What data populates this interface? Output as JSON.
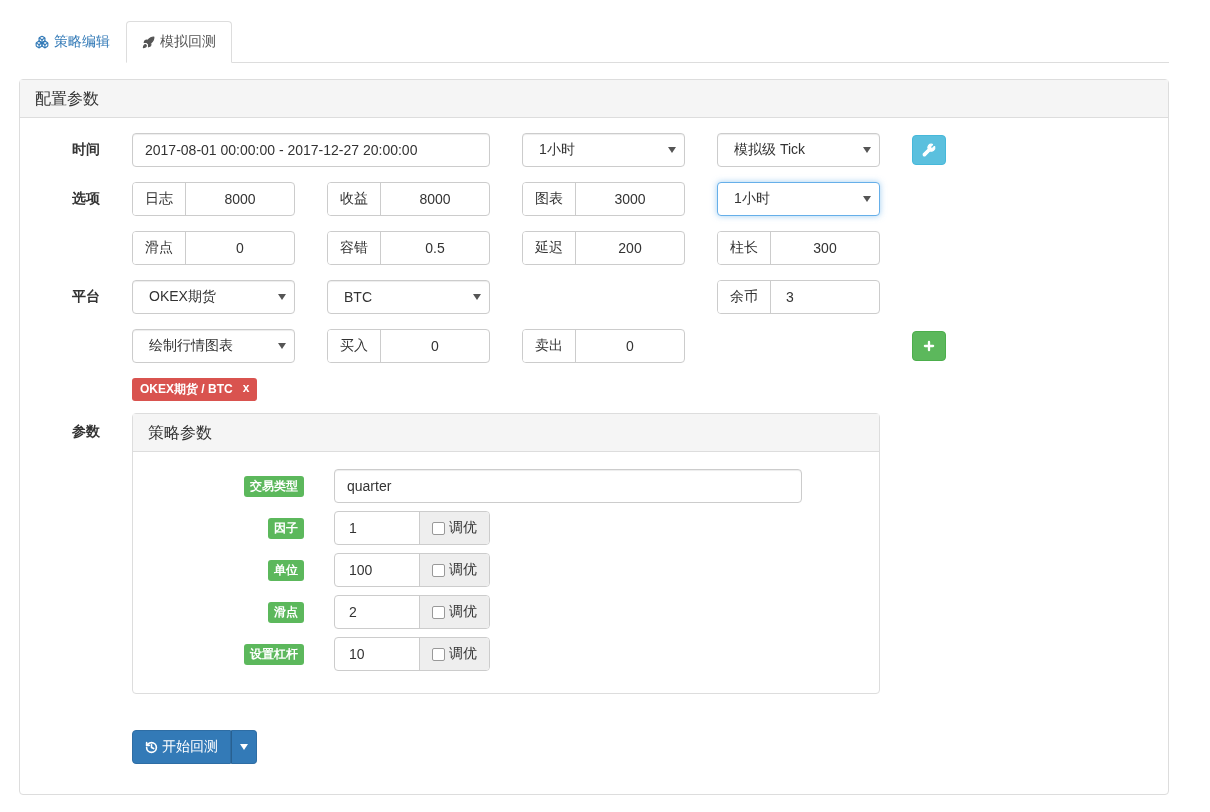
{
  "tabs": [
    {
      "label": "策略编辑",
      "selected": false
    },
    {
      "label": "模拟回测",
      "selected": true
    }
  ],
  "panel": {
    "title": "配置参数",
    "rows": [
      {
        "label": "时间",
        "items": [
          {
            "kind": "range",
            "value": "2017-08-01 00:00:00 - 2017-12-27 20:00:00"
          },
          {
            "kind": "select",
            "value": "1小时",
            "focused": false
          },
          {
            "kind": "select",
            "value": "模拟级 Tick",
            "focused": false
          },
          {
            "kind": "settings"
          }
        ]
      },
      {
        "label": "选项",
        "items": [
          {
            "kind": "addon",
            "label": "日志",
            "value": "8000"
          },
          {
            "kind": "addon",
            "label": "收益",
            "value": "8000"
          },
          {
            "kind": "addon",
            "label": "图表",
            "value": "3000"
          },
          {
            "kind": "select",
            "value": "1小时",
            "focused": true
          }
        ]
      },
      {
        "items": [
          {
            "kind": "addon",
            "label": "滑点",
            "value": "0"
          },
          {
            "kind": "addon",
            "label": "容错",
            "value": "0.5"
          },
          {
            "kind": "addon",
            "label": "延迟",
            "value": "200"
          },
          {
            "kind": "addon",
            "label": "柱长",
            "value": "300"
          }
        ]
      },
      {
        "label": "平台",
        "items": [
          {
            "kind": "select",
            "value": "OKEX期货",
            "focused": false
          },
          {
            "kind": "select",
            "value": "BTC",
            "focused": false
          },
          {
            "kind": "empty"
          },
          {
            "kind": "leftaddon",
            "label": "余币",
            "value": "3"
          }
        ]
      },
      {
        "items": [
          {
            "kind": "select",
            "value": "绘制行情图表",
            "focused": false
          },
          {
            "kind": "addon",
            "label": "买入",
            "value": "0"
          },
          {
            "kind": "addon",
            "label": "卖出",
            "value": "0"
          },
          {
            "kind": "empty"
          },
          {
            "kind": "add"
          }
        ]
      }
    ],
    "tags": [
      {
        "label": "OKEX期货 / BTC",
        "close": "x"
      }
    ],
    "params": {
      "label": "参数",
      "title": "策略参数",
      "rows": [
        {
          "label": "交易类型",
          "kind": "text",
          "value": "quarter"
        },
        {
          "label": "因子",
          "kind": "number",
          "value": "1",
          "optimize": {
            "label": "调优",
            "checked": false
          }
        },
        {
          "label": "单位",
          "kind": "number",
          "value": "100",
          "optimize": {
            "label": "调优",
            "checked": false
          }
        },
        {
          "label": "滑点",
          "kind": "number",
          "value": "2",
          "optimize": {
            "label": "调优",
            "checked": false
          }
        },
        {
          "label": "设置杠杆",
          "kind": "number",
          "value": "10",
          "optimize": {
            "label": "调优",
            "checked": false
          }
        }
      ]
    },
    "start_button": {
      "label": "开始回测"
    }
  }
}
